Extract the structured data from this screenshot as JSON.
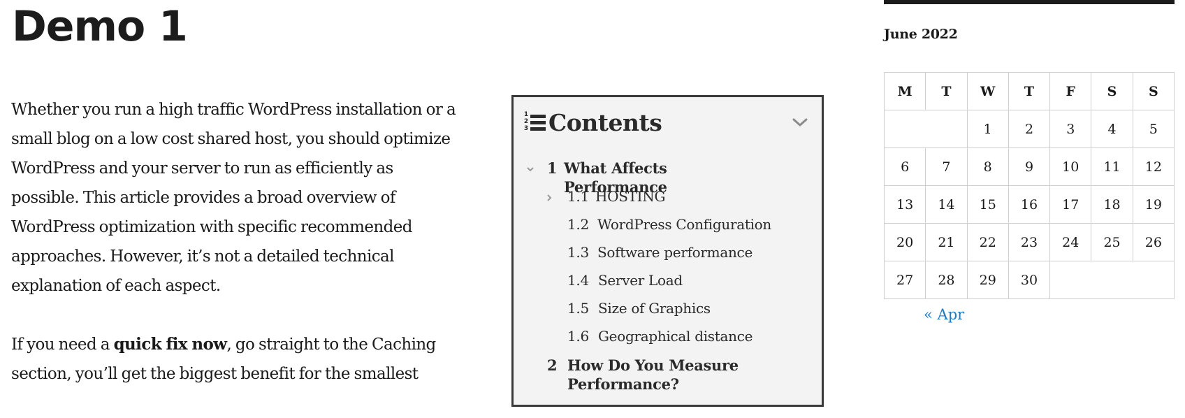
{
  "page": {
    "title": "Demo 1"
  },
  "article": {
    "paragraph1_lines": [
      "Whether you run a high traffic WordPress installation or a",
      "small blog on a low cost shared host, you should optimize",
      "WordPress and your server to run as efficiently as",
      "possible. This article provides a broad overview of",
      "WordPress optimization with specific recommended",
      "approaches. However, it’s not a detailed technical",
      "explanation of each aspect."
    ],
    "paragraph2": {
      "line1_before": "If you need a ",
      "line1_bold": "quick fix now",
      "line1_after": ", go straight to the Caching",
      "line2": "section, you’ll get the biggest benefit for the smallest"
    }
  },
  "toc": {
    "title": "Contents",
    "icon": "numbered-list-icon",
    "toggle_icon": "chevron-down-icon",
    "items": [
      {
        "level": 1,
        "number": "1",
        "label": "What Affects Performance",
        "chevron": "chevron-down-icon"
      },
      {
        "level": 2,
        "number": "1.1",
        "label": "HOSTING",
        "chevron": "chevron-right-icon"
      },
      {
        "level": 2,
        "number": "1.2",
        "label": "WordPress Configuration"
      },
      {
        "level": 2,
        "number": "1.3",
        "label": "Software performance"
      },
      {
        "level": 2,
        "number": "1.4",
        "label": "Server Load"
      },
      {
        "level": 2,
        "number": "1.5",
        "label": "Size of Graphics"
      },
      {
        "level": 2,
        "number": "1.6",
        "label": "Geographical distance"
      },
      {
        "level": 1,
        "number": "2",
        "label": "How Do You Measure Performance?"
      }
    ]
  },
  "calendar": {
    "caption": "June 2022",
    "weekdays": [
      "M",
      "T",
      "W",
      "T",
      "F",
      "S",
      "S"
    ],
    "weeks": [
      [
        "",
        "",
        "1",
        "2",
        "3",
        "4",
        "5"
      ],
      [
        "6",
        "7",
        "8",
        "9",
        "10",
        "11",
        "12"
      ],
      [
        "13",
        "14",
        "15",
        "16",
        "17",
        "18",
        "19"
      ],
      [
        "20",
        "21",
        "22",
        "23",
        "24",
        "25",
        "26"
      ],
      [
        "27",
        "28",
        "29",
        "30",
        "",
        "",
        ""
      ]
    ],
    "prev_link": "« Apr",
    "link_color": "#1e7ac2"
  }
}
